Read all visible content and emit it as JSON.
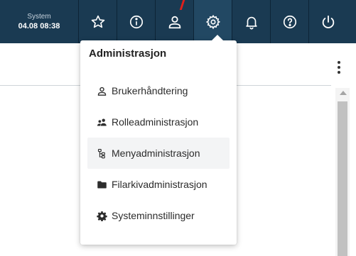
{
  "topbar": {
    "system_label": "System",
    "system_time": "04.08 08:38",
    "buttons": [
      {
        "icon": "star-icon"
      },
      {
        "icon": "info-icon"
      },
      {
        "icon": "user-icon"
      },
      {
        "icon": "gear-icon",
        "active": true
      },
      {
        "icon": "bell-icon"
      },
      {
        "icon": "help-icon"
      },
      {
        "icon": "power-icon"
      }
    ],
    "colors": {
      "background": "#1a3a52",
      "pointer": "#e0201b"
    }
  },
  "dropdown": {
    "title": "Administrasjon",
    "items": [
      {
        "label": "Brukerhåndtering",
        "icon": "user-outline-icon"
      },
      {
        "label": "Rolleadministrasjon",
        "icon": "users-group-icon"
      },
      {
        "label": "Menyadministrasjon",
        "icon": "tree-structure-icon"
      },
      {
        "label": "Filarkivadministrasjon",
        "icon": "folder-icon"
      },
      {
        "label": "Systeminnstillinger",
        "icon": "cog-icon"
      }
    ]
  }
}
